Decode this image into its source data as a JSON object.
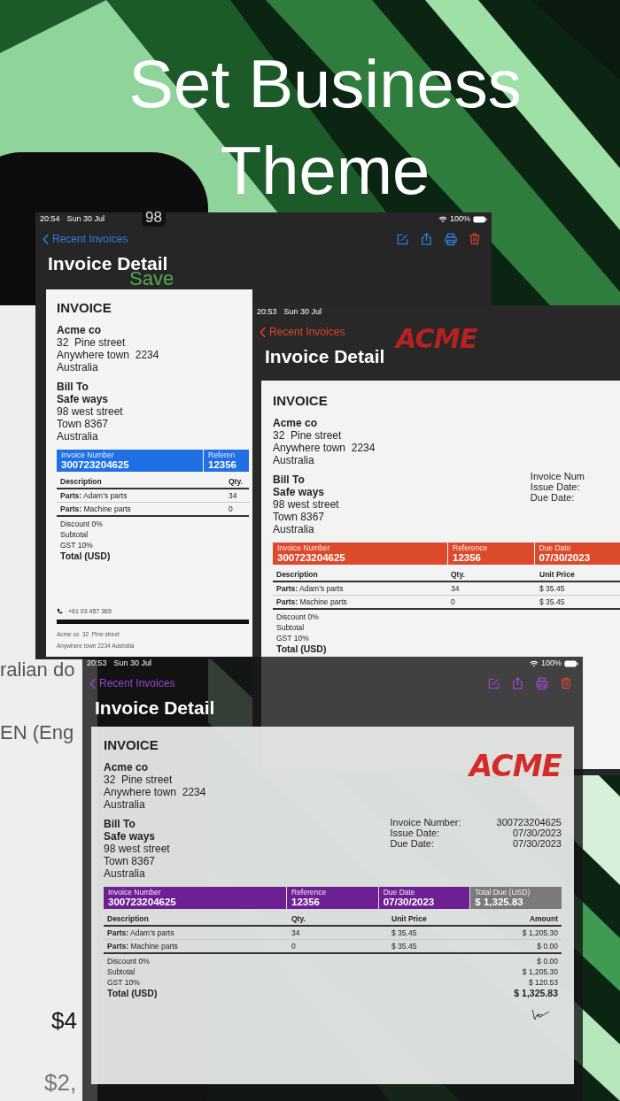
{
  "headline": {
    "lines": [
      "Set Business",
      "Theme"
    ]
  },
  "back_phone": {
    "battery": "98",
    "button": "Save",
    "rows": [
      "ralian do",
      "EN (Eng",
      "$4",
      "$2,"
    ]
  },
  "screens": [
    {
      "status": {
        "time": "20:54",
        "date": "Sun 30 Jul",
        "battery": "100%"
      },
      "back": "Recent Invoices",
      "title": "Invoice Detail",
      "color": "#2f7de0",
      "toolbar": [
        {
          "kind": "edit"
        },
        {
          "kind": "share"
        },
        {
          "kind": "print"
        },
        {
          "kind": "delete"
        }
      ],
      "invoice": {
        "heading": "INVOICE",
        "from": [
          "Acme co",
          "32  Pine street",
          "Anywhere town  2234",
          "Australia"
        ],
        "bill_to": [
          "Bill To",
          "Safe ways",
          "98 west street",
          "Town 8367",
          "Australia"
        ],
        "band": [
          {
            "label": "Invoice Number",
            "value": "300723204625",
            "color": "#1f6fe5"
          },
          {
            "label": "Referen",
            "value": "12356",
            "color": "#1f6fe5"
          }
        ],
        "columns": [
          "Description",
          "Qty."
        ],
        "items": [
          {
            "description": "**Parts:** Adam’s parts",
            "cells": [
              "34"
            ]
          },
          {
            "description": "**Parts:** Machine parts",
            "cells": [
              "0"
            ]
          }
        ],
        "totals": [
          {
            "label": "Discount 0%"
          },
          {
            "label": "Subtotal"
          },
          {
            "label": "GST 10%"
          },
          {
            "label": "Total (USD)",
            "kind": "grand"
          }
        ],
        "footer": {
          "phone": "+61 03 457 365",
          "address": [
            "Acme co  32  Pine street",
            "Anywhere town 2234 Australia"
          ]
        }
      }
    },
    {
      "status": {
        "time": "20:53",
        "date": "Sun 30 Jul"
      },
      "back": "Recent Invoices",
      "title": "Invoice Detail",
      "color": "#e0452c",
      "logo": "ACME",
      "invoice": {
        "heading": "INVOICE",
        "from": [
          "Acme co",
          "32  Pine street",
          "Anywhere town  2234",
          "Australia"
        ],
        "bill_to": [
          "Bill To",
          "Safe ways",
          "98 west street",
          "Town 8367",
          "Australia"
        ],
        "meta": [
          {
            "label": "Invoice Num"
          },
          {
            "label": "Issue Date:"
          },
          {
            "label": "Due Date:"
          }
        ],
        "band": [
          {
            "label": "Invoice Number",
            "value": "300723204625",
            "color": "#dc4a2c"
          },
          {
            "label": "Reference",
            "value": "12356",
            "color": "#dc4a2c"
          },
          {
            "label": "Due Date",
            "value": "07/30/2023",
            "color": "#dc4a2c"
          }
        ],
        "columns": [
          "Description",
          "Qty.",
          "Unit Price"
        ],
        "items": [
          {
            "description": "**Parts:** Adam’s parts",
            "cells": [
              "34",
              "$ 35.45"
            ]
          },
          {
            "description": "**Parts:** Machine parts",
            "cells": [
              "0",
              "$ 35.45"
            ]
          }
        ],
        "totals": [
          {
            "label": "Discount 0%"
          },
          {
            "label": "Subtotal"
          },
          {
            "label": "GST 10%"
          },
          {
            "label": "Total (USD)",
            "kind": "grand"
          }
        ]
      }
    },
    {
      "status": {
        "time": "20:53",
        "date": "Sun 30 Jul",
        "battery": "100%"
      },
      "back": "Recent Invoices",
      "title": "Invoice Detail",
      "color": "#9b45d0",
      "toolbar": [
        {
          "kind": "edit"
        },
        {
          "kind": "share"
        },
        {
          "kind": "print"
        },
        {
          "kind": "delete"
        }
      ],
      "invoice": {
        "heading": "INVOICE",
        "logo": "ACME",
        "from": [
          "Acme co",
          "32  Pine street",
          "Anywhere town  2234",
          "Australia"
        ],
        "bill_to": [
          "Bill To",
          "Safe ways",
          "98 west street",
          "Town 8367",
          "Australia"
        ],
        "meta": [
          {
            "label": "Invoice Number:",
            "value": "300723204625"
          },
          {
            "label": "Issue Date:",
            "value": "07/30/2023"
          },
          {
            "label": "Due Date:",
            "value": "07/30/2023"
          }
        ],
        "band": [
          {
            "label": "Invoice Number",
            "value": "300723204625",
            "color": "#6f1f94"
          },
          {
            "label": "Reference",
            "value": "12356",
            "color": "#6f1f94"
          },
          {
            "label": "Due Date",
            "value": "07/30/2023",
            "color": "#6f1f94"
          },
          {
            "label": "Total Due (USD)",
            "value": "$ 1,325.83",
            "color": "#7a7a7a"
          }
        ],
        "columns": [
          "Description",
          "Qty.",
          "Unit Price",
          "Amount"
        ],
        "items": [
          {
            "description": "**Parts:** Adam’s parts",
            "cells": [
              "34",
              "$ 35.45",
              "$ 1,205.30"
            ]
          },
          {
            "description": "**Parts:** Machine parts",
            "cells": [
              "0",
              "$ 35.45",
              "$ 0.00"
            ]
          }
        ],
        "totals": [
          {
            "label": "Discount 0%",
            "value": "$ 0.00"
          },
          {
            "label": "Subtotal",
            "value": "$ 1,205.30"
          },
          {
            "label": "GST 10%",
            "value": "$ 120.53"
          },
          {
            "label": "Total (USD)",
            "value": "$ 1,325.83",
            "kind": "grand"
          }
        ],
        "signature": true
      }
    }
  ]
}
